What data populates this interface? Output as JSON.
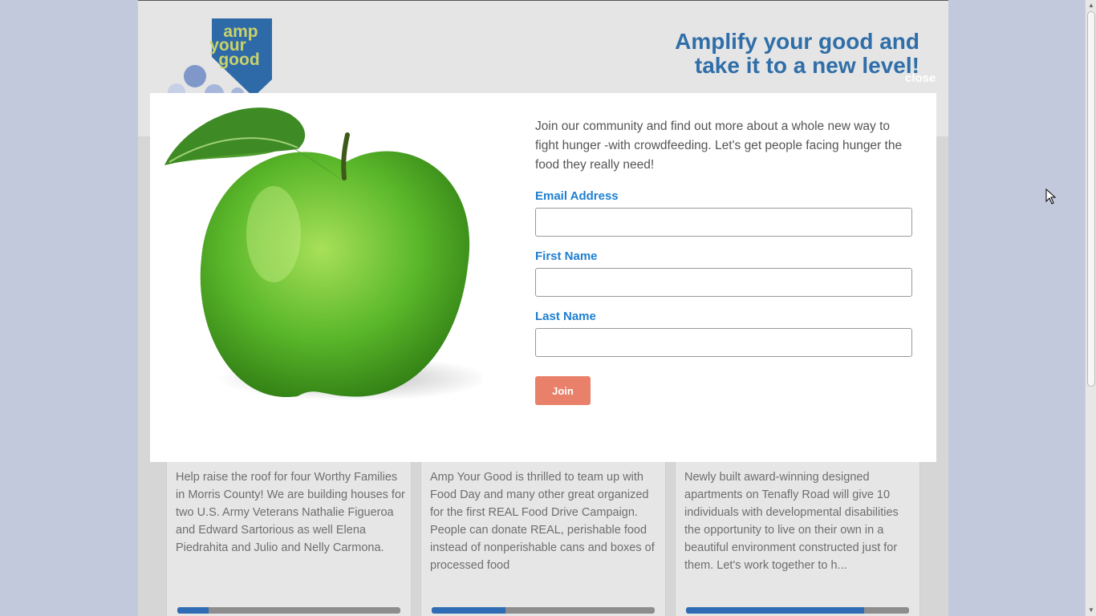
{
  "brand": {
    "logo_lines": [
      "amp",
      "your",
      "good"
    ],
    "tagline_line1": "Amplify your good and",
    "tagline_line2": "take it to a new level!"
  },
  "modal": {
    "close_label": "close",
    "intro": "Join our community and find out more about a whole new way to fight hunger -with crowdfeeding.  Let's get people facing hunger the food they really need!",
    "email_label": "Email Address",
    "email_value": "",
    "first_name_label": "First Name",
    "first_name_value": "",
    "last_name_label": "Last Name",
    "last_name_value": "",
    "join_label": "Join"
  },
  "campaigns": [
    {
      "description": "Help raise the roof for four Worthy Families in Morris County! We are building houses for two U.S. Army Veterans Nathalie Figueroa and Edward Sartorious as well Elena Piedrahita and Julio and Nelly Carmona.",
      "progress": 0.14
    },
    {
      "description": "Amp Your Good is thrilled to team up with Food Day and many other great organized for the first REAL Food Drive Campaign. People can donate REAL, perishable food instead of nonperishable cans and boxes of processed food",
      "progress": 0.33
    },
    {
      "description": "Newly built award-winning designed apartments on Tenafly Road will give 10 individuals with developmental disabilities the opportunity to live on their own in a beautiful environment constructed just for them. Let's work together to h...",
      "progress": 0.8
    }
  ],
  "colors": {
    "page_background": "#c2c9dd",
    "tagline": "#2f6ea8",
    "field_label": "#1e7fd1",
    "join_button": "#e9806a",
    "progress_fill": "#2e6db4",
    "logo_blue": "#2f6aa8",
    "logo_text": "#c9d26a"
  },
  "icons": {
    "cursor": "arrow-cursor-icon",
    "apple": "green-apple-image"
  }
}
